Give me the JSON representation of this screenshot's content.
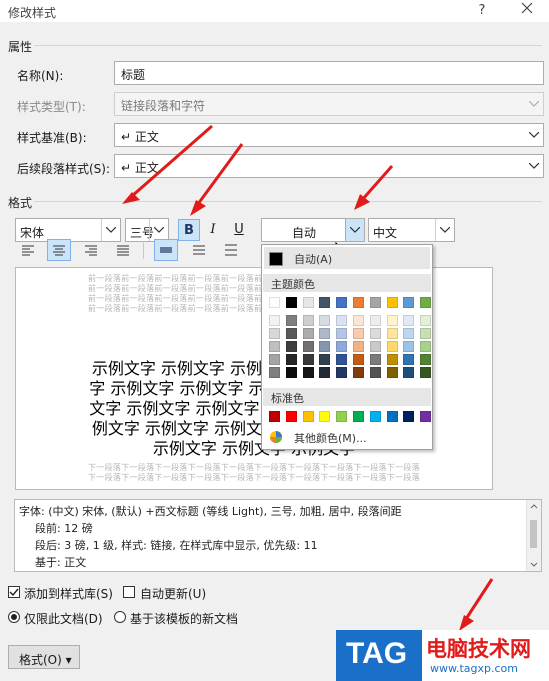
{
  "dialog": {
    "title": "修改样式",
    "help_icon": "help-icon",
    "close_icon": "close-icon"
  },
  "properties": {
    "section_label": "属性",
    "name_label": "名称(N):",
    "name_value": "标题",
    "style_type_label": "样式类型(T):",
    "style_type_value": "链接段落和字符",
    "based_on_label": "样式基准(B):",
    "based_on_value": "↵ 正文",
    "following_label": "后续段落样式(S):",
    "following_value": "↵ 正文"
  },
  "format": {
    "section_label": "格式",
    "font_value": "宋体",
    "size_value": "三号",
    "bold_label": "B",
    "italic_label": "I",
    "underline_label": "U",
    "color_value": "自动",
    "script_value": "中文"
  },
  "color_palette": {
    "auto_label": "自动(A)",
    "theme_header": "主题颜色",
    "standard_header": "标准色",
    "more_colors_label": "其他颜色(M)...",
    "theme_top_row": [
      "#ffffff",
      "#000000",
      "#e7e6e6",
      "#44546a",
      "#4472c4",
      "#ed7d31",
      "#a5a5a5",
      "#ffc000",
      "#5b9bd5",
      "#70ad47"
    ],
    "theme_shades": [
      [
        "#f2f2f2",
        "#7f7f7f",
        "#d0cece",
        "#d6dce4",
        "#d9e2f3",
        "#fbe5d5",
        "#ededed",
        "#fff2cc",
        "#deebf6",
        "#e2efd9"
      ],
      [
        "#d8d8d8",
        "#595959",
        "#aeabab",
        "#adb9ca",
        "#b4c6e7",
        "#f7cbac",
        "#dbdbdb",
        "#fee599",
        "#bdd7ee",
        "#c5e0b3"
      ],
      [
        "#bfbfbf",
        "#3f3f3f",
        "#757070",
        "#8496b0",
        "#8eaadb",
        "#f4b183",
        "#c9c9c9",
        "#ffd965",
        "#9cc3e5",
        "#a8d08d"
      ],
      [
        "#a5a5a5",
        "#262626",
        "#3a3838",
        "#323f4f",
        "#2f5496",
        "#c55a11",
        "#7b7b7b",
        "#bf8f00",
        "#2e75b5",
        "#538135"
      ],
      [
        "#7f7f7f",
        "#0c0c0c",
        "#171616",
        "#222a35",
        "#1f3864",
        "#833c0b",
        "#525252",
        "#7f6000",
        "#1e4e79",
        "#375623"
      ]
    ],
    "standard_colors": [
      "#c00000",
      "#ff0000",
      "#ffc000",
      "#ffff00",
      "#92d050",
      "#00b050",
      "#00b0f0",
      "#0070c0",
      "#002060",
      "#7030a0"
    ]
  },
  "preview": {
    "prev_paragraph": "前一段落前一段落前一段落前一段落前一段落前一段落前一段落前一段落前一段落前一段落",
    "next_paragraph": "下一段落下一段落下一段落下一段落下一段落下一段落下一段落下一段落下一段落下一段落",
    "sample_lines": [
      "示例文字 示例文字 示例文字 示例文字 示例文",
      "字 示例文字 示例文字 示例文字 示例文字 示例",
      "文字 示例文字 示例文字 示例文字 示例文字 示",
      "例文字 示例文字 示例文字 示例文字 示例文字",
      "示例文字 示例文字 示例文字"
    ]
  },
  "description": {
    "line1": "字体: (中文) 宋体, (默认) +西文标题 (等线 Light), 三号, 加粗, 居中, 段落间距",
    "line2": "段前: 12 磅",
    "line3": "段后: 3 磅, 1 级, 样式: 链接, 在样式库中显示, 优先级: 11",
    "line4": "基于: 正文"
  },
  "options": {
    "add_to_gallery": "添加到样式库(S)",
    "auto_update": "自动更新(U)",
    "only_this_doc": "仅限此文档(D)",
    "new_docs_template": "基于该模板的新文档",
    "format_button": "格式(O) ▾"
  },
  "watermark": {
    "logo_text": "TAG",
    "site_name": "电脑技术网",
    "site_url": "www.tagxp.com"
  },
  "colors": {
    "accent_selected": "#cce4f7",
    "annotation_red": "#e11a1a",
    "logo_blue": "#1a6fc9"
  }
}
